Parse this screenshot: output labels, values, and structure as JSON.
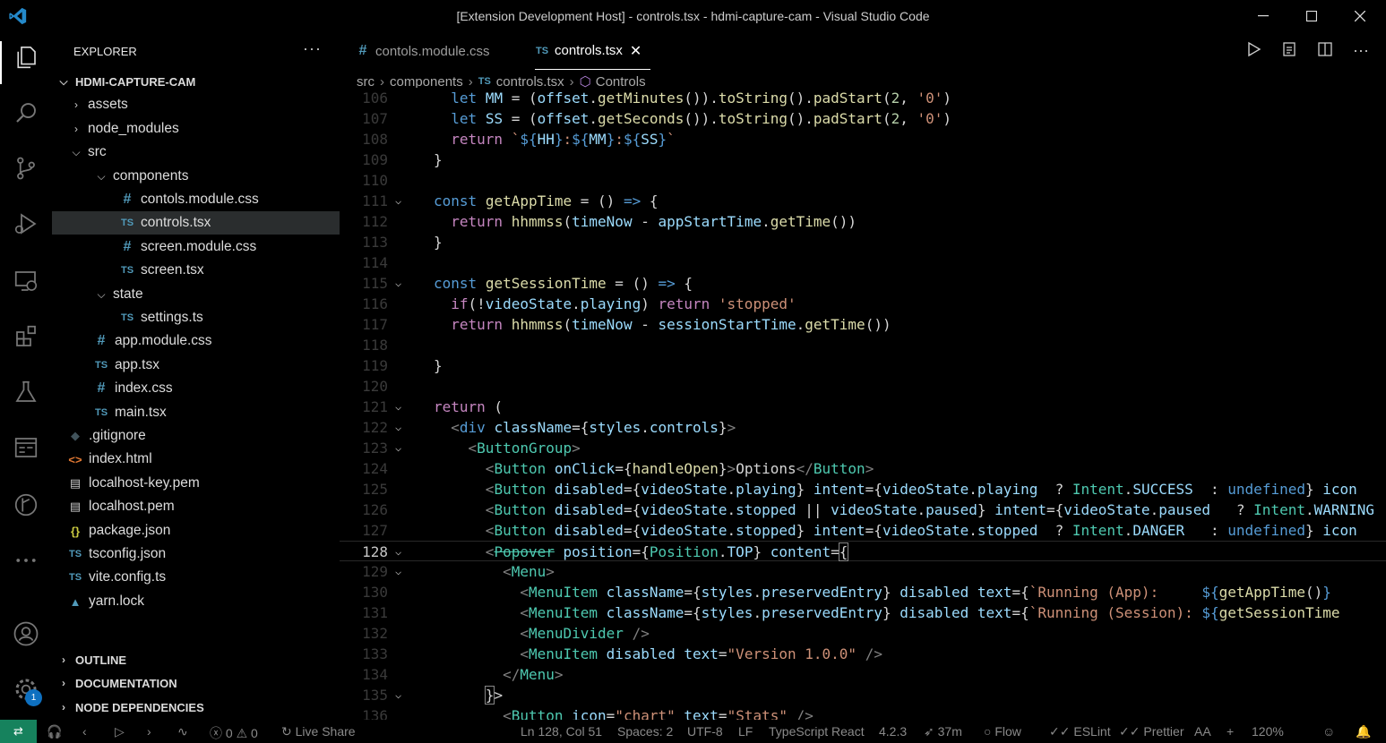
{
  "window": {
    "title": "[Extension Development Host] - controls.tsx - hdmi-capture-cam - Visual Studio Code"
  },
  "sidebar": {
    "header": "EXPLORER",
    "root": "HDMI-CAPTURE-CAM",
    "items": [
      {
        "label": "assets"
      },
      {
        "label": "node_modules"
      },
      {
        "label": "src"
      },
      {
        "label": "components"
      },
      {
        "label": "contols.module.css",
        "icon": "#"
      },
      {
        "label": "controls.tsx",
        "icon": "TS"
      },
      {
        "label": "screen.module.css",
        "icon": "#"
      },
      {
        "label": "screen.tsx",
        "icon": "TS"
      },
      {
        "label": "state"
      },
      {
        "label": "settings.ts",
        "icon": "TS"
      },
      {
        "label": "app.module.css",
        "icon": "#"
      },
      {
        "label": "app.tsx",
        "icon": "TS"
      },
      {
        "label": "index.css",
        "icon": "#"
      },
      {
        "label": "main.tsx",
        "icon": "TS"
      },
      {
        "label": ".gitignore",
        "icon": "◆"
      },
      {
        "label": "index.html",
        "icon": "<>"
      },
      {
        "label": "localhost-key.pem",
        "icon": "▤"
      },
      {
        "label": "localhost.pem",
        "icon": "▤"
      },
      {
        "label": "package.json",
        "icon": "{}"
      },
      {
        "label": "tsconfig.json",
        "icon": "TS"
      },
      {
        "label": "vite.config.ts",
        "icon": "TS"
      },
      {
        "label": "yarn.lock",
        "icon": "▲"
      }
    ],
    "sections": [
      "OUTLINE",
      "DOCUMENTATION",
      "NODE DEPENDENCIES"
    ]
  },
  "tabs": [
    {
      "label": "contols.module.css",
      "icon": "#"
    },
    {
      "label": "controls.tsx",
      "icon": "TS",
      "close": "✕"
    }
  ],
  "breadcrumb": [
    "src",
    "components",
    "controls.tsx",
    "Controls"
  ],
  "breadcrumb_icons": {
    "ts": "TS",
    "symbol": "⬡"
  },
  "editor": {
    "line_numbers": [
      "106",
      "107",
      "108",
      "109",
      "110",
      "111",
      "112",
      "113",
      "114",
      "115",
      "116",
      "117",
      "118",
      "119",
      "120",
      "121",
      "122",
      "123",
      "124",
      "125",
      "126",
      "127",
      "128",
      "129",
      "130",
      "131",
      "132",
      "133",
      "134",
      "135",
      "136"
    ],
    "current_line": "128"
  },
  "statusbar": {
    "errors": "0",
    "warnings": "0",
    "live_share": "Live Share",
    "position": "Ln 128, Col 51",
    "spaces": "Spaces: 2",
    "encoding": "UTF-8",
    "eol": "LF",
    "language": "TypeScript React",
    "ts_version": "4.2.3",
    "time": "37m",
    "flow": "Flow",
    "eslint": "ESLint",
    "prettier": "Prettier",
    "zoom": "120%",
    "plus": "+",
    "aa": "AA"
  },
  "badge": {
    "count": "1"
  },
  "colors": {
    "accent": "#0e70c0",
    "remote": "#16825d",
    "keyword": "#569cd6",
    "string": "#ce9178",
    "type": "#4ec9b0"
  }
}
